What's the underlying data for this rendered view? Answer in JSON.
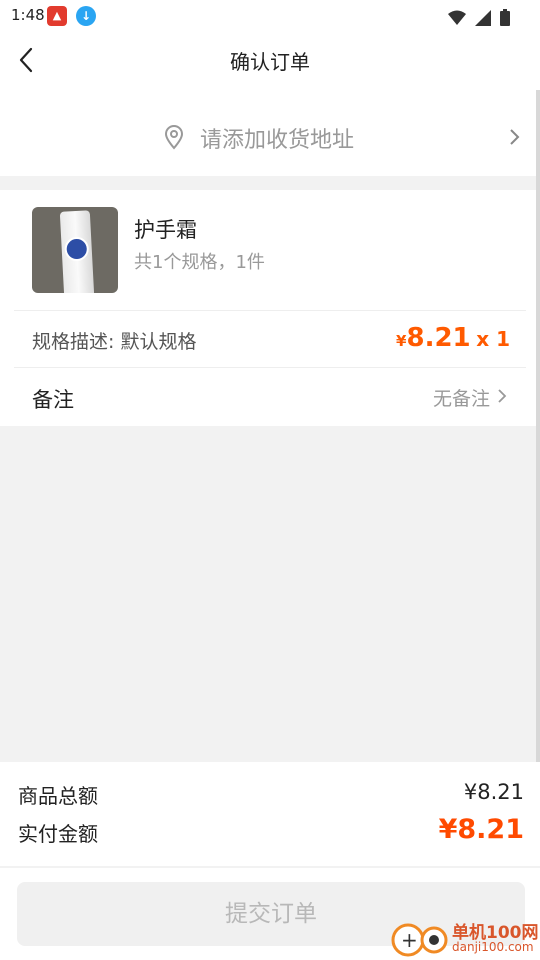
{
  "status_bar": {
    "time": "1:48"
  },
  "nav": {
    "title": "确认订单"
  },
  "address": {
    "placeholder": "请添加收货地址"
  },
  "product": {
    "name": "护手霜",
    "summary": "共1个规格，1件",
    "spec_label": "规格描述: 默认规格",
    "currency": "¥",
    "price": "8.21",
    "quantity": "x 1"
  },
  "note": {
    "label": "备注",
    "value": "无备注"
  },
  "totals": {
    "goods_total_label": "商品总额",
    "goods_total_value": "¥8.21",
    "paid_label": "实付金额",
    "paid_value": "¥8.21"
  },
  "submit": {
    "label": "提交订单"
  },
  "watermark": {
    "brand": "单机100网",
    "domain": "danji100.com"
  },
  "colors": {
    "accent": "#ff5a00",
    "muted": "#999999",
    "background": "#f2f2f2"
  }
}
